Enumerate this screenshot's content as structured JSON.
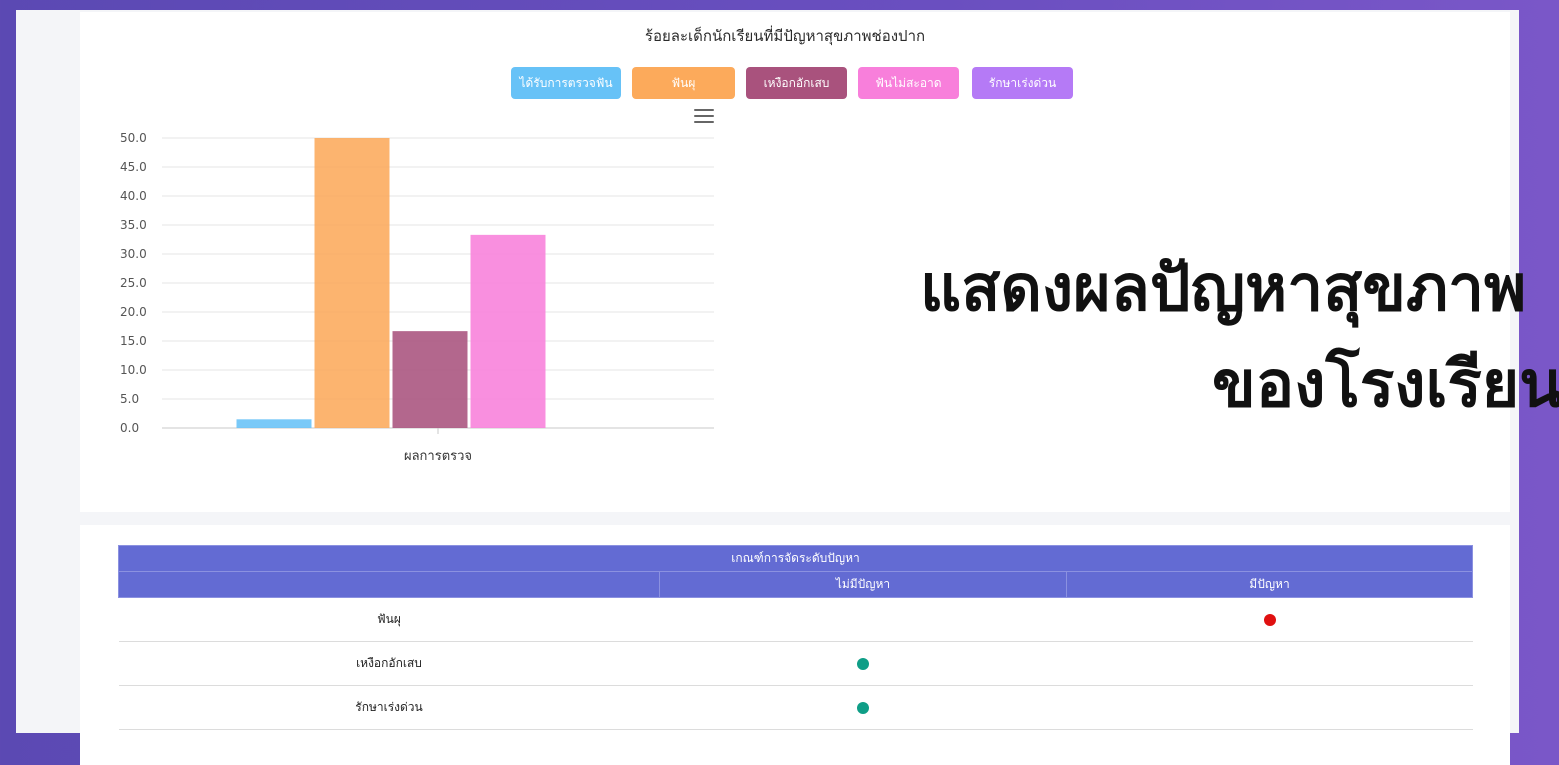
{
  "chart_data": {
    "type": "bar",
    "title": "ร้อยละเด็กนักเรียนที่มีปัญหาสุขภาพช่องปาก",
    "categories": [
      "ผลการตรวจ"
    ],
    "series": [
      {
        "name": "ได้รับการตรวจฟัน",
        "values": [
          1.5
        ],
        "color": "#67c2f7"
      },
      {
        "name": "ฟันผุ",
        "values": [
          50.0
        ],
        "color": "#fcaa5b"
      },
      {
        "name": "เหงือกอักเสบ",
        "values": [
          16.7
        ],
        "color": "#a9527d"
      },
      {
        "name": "ฟันไม่สะอาด",
        "values": [
          33.3
        ],
        "color": "#f87fdb"
      },
      {
        "name": "รักษาเร่งด่วน",
        "values": [
          0.0
        ],
        "color": "#b57af6"
      }
    ],
    "ylim": [
      0,
      50
    ],
    "yticks": [
      "0.0",
      "5.0",
      "10.0",
      "15.0",
      "20.0",
      "25.0",
      "30.0",
      "35.0",
      "40.0",
      "45.0",
      "50.0"
    ],
    "xlabel": "ผลการตรวจ",
    "ylabel": "",
    "grid": true,
    "legend": "top"
  },
  "overlay": {
    "line1": "แสดงผลปัญหาสุขภาพ",
    "line2": "ของโรงเรียน"
  },
  "table": {
    "header": "เกณฑ์การจัดระดับปัญหา",
    "columns": [
      "",
      "ไม่มีปัญหา",
      "มีปัญหา"
    ],
    "rows": [
      {
        "label": "ฟันผุ",
        "status": "problem"
      },
      {
        "label": "เหงือกอักเสบ",
        "status": "ok"
      },
      {
        "label": "รักษาเร่งด่วน",
        "status": "ok"
      }
    ],
    "ok_color": "#0f9e87",
    "problem_color": "#e01010"
  }
}
